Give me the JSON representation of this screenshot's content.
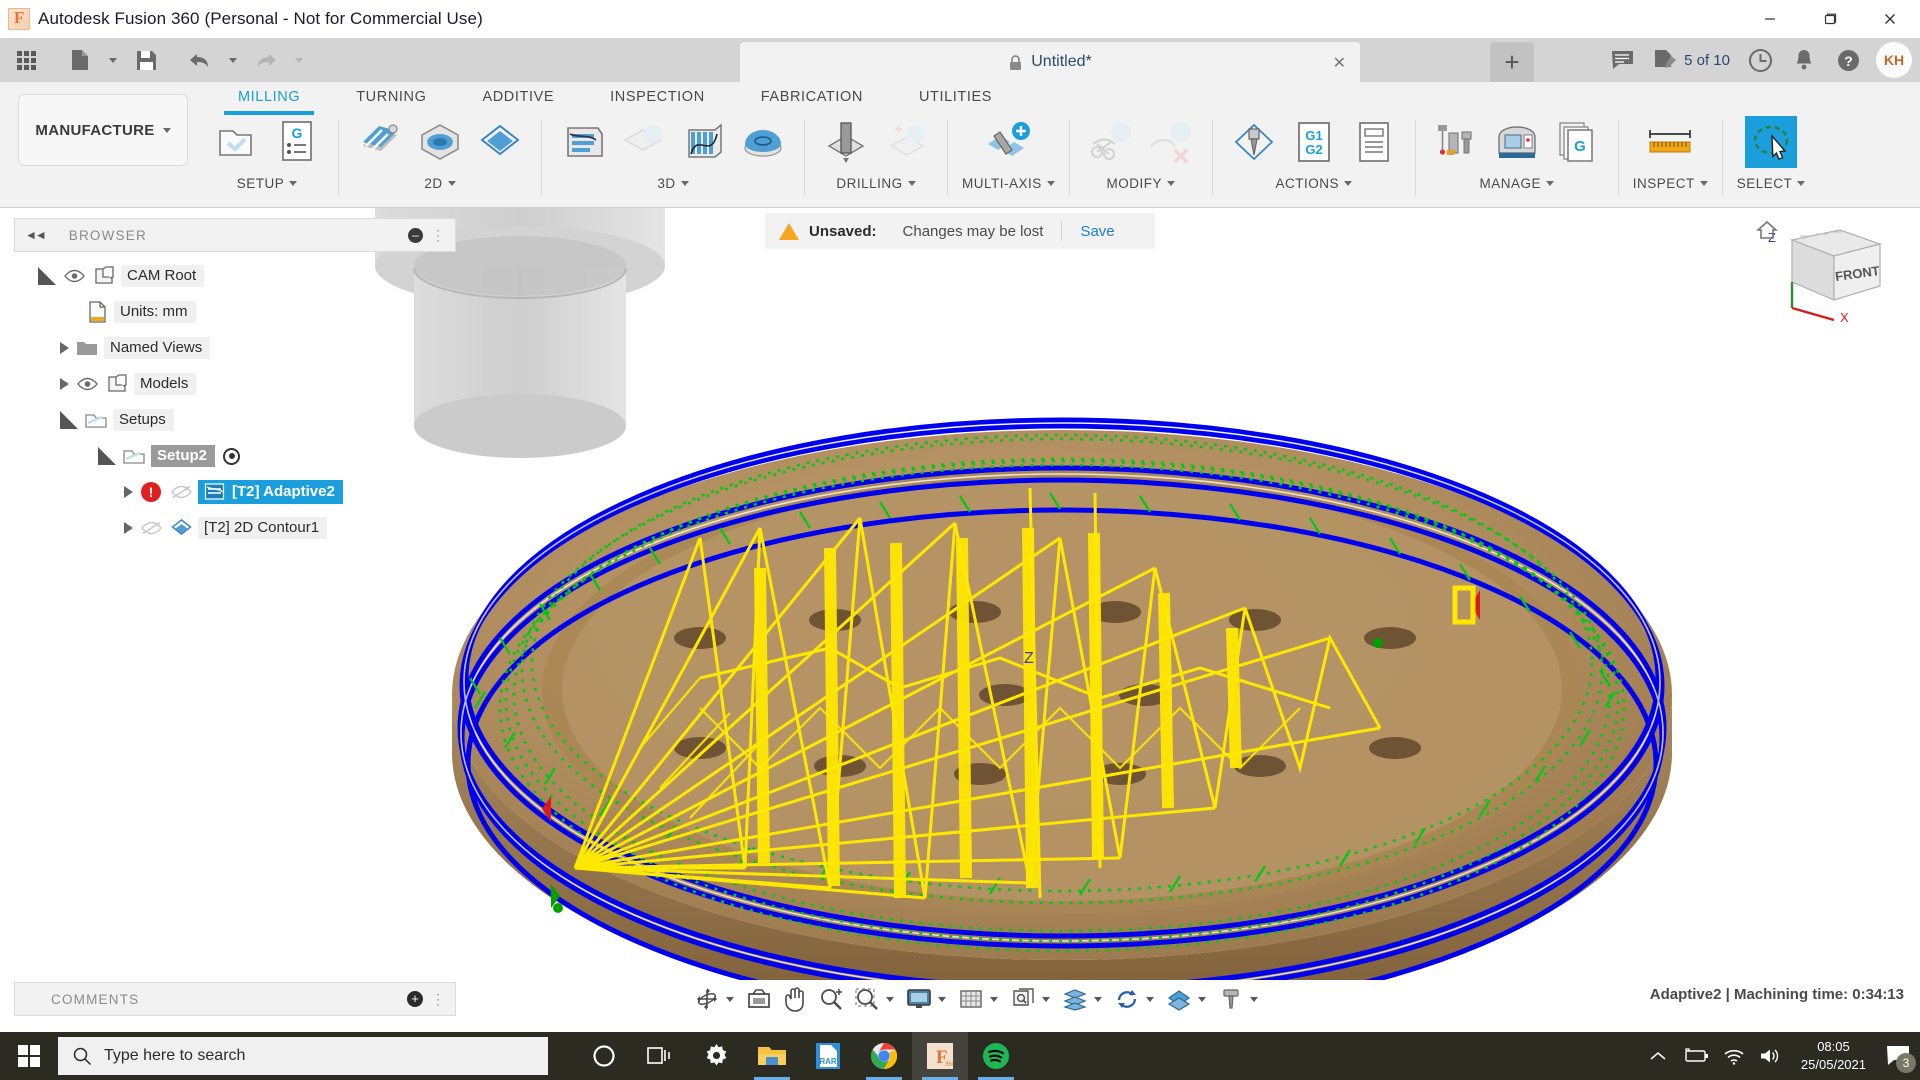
{
  "window": {
    "app_title": "Autodesk Fusion 360 (Personal - Not for Commercial Use)",
    "minimize_label": "–",
    "maximize_label": "❐",
    "close_label": "✕"
  },
  "quick_access": {
    "grid_icon": "app-grid-icon",
    "new_icon": "new-document-icon",
    "save_icon": "save-icon",
    "undo_icon": "undo-icon",
    "redo_icon": "redo-icon",
    "document_tab": {
      "title": "Untitled*",
      "lock_icon": "lock-icon",
      "close_label": "✕"
    },
    "new_tab_label": "+",
    "comment_icon": "comment-icon",
    "jobs_label": "5 of 10",
    "jobs_icon": "job-status-icon",
    "history_icon": "clock-icon",
    "notifications_icon": "bell-icon",
    "help_icon": "help-icon",
    "user_initials": "KH"
  },
  "ribbon": {
    "workspace": "MANUFACTURE",
    "tabs": [
      {
        "label": "MILLING",
        "active": true
      },
      {
        "label": "TURNING",
        "active": false
      },
      {
        "label": "ADDITIVE",
        "active": false
      },
      {
        "label": "INSPECTION",
        "active": false
      },
      {
        "label": "FABRICATION",
        "active": false
      },
      {
        "label": "UTILITIES",
        "active": false
      }
    ],
    "groups": [
      {
        "label": "SETUP",
        "dropdown": true
      },
      {
        "label": "2D",
        "dropdown": true
      },
      {
        "label": "3D",
        "dropdown": true
      },
      {
        "label": "DRILLING",
        "dropdown": true
      },
      {
        "label": "MULTI-AXIS",
        "dropdown": true
      },
      {
        "label": "MODIFY",
        "dropdown": true
      },
      {
        "label": "ACTIONS",
        "dropdown": true
      },
      {
        "label": "MANAGE",
        "dropdown": true
      },
      {
        "label": "INSPECT",
        "dropdown": true
      },
      {
        "label": "SELECT",
        "dropdown": true
      }
    ]
  },
  "browser": {
    "title": "BROWSER",
    "collapse_icon": "collapse-left-icon",
    "minimize_icon": "minimize-panel-icon",
    "grip_icon": "resize-grip-icon",
    "tree": [
      {
        "label": "CAM Root",
        "indent": 0,
        "expander": "open",
        "eye": "on",
        "icon": "body-icon"
      },
      {
        "label": "Units: mm",
        "indent": 1,
        "expander": "none",
        "eye": "none",
        "icon": "units-document-icon"
      },
      {
        "label": "Named Views",
        "indent": 1,
        "expander": "closed",
        "eye": "none",
        "icon": "folder-icon"
      },
      {
        "label": "Models",
        "indent": 1,
        "expander": "closed",
        "eye": "on",
        "icon": "body-icon"
      },
      {
        "label": "Setups",
        "indent": 1,
        "expander": "open",
        "eye": "none",
        "icon": "setup-icon"
      },
      {
        "label": "Setup2",
        "indent": 2,
        "expander": "open",
        "eye": "none",
        "icon": "setup-icon",
        "style": "setup",
        "radio": true
      },
      {
        "label": "[T2] Adaptive2",
        "indent": 3,
        "expander": "closed",
        "eye": "off",
        "icon": "adaptive-toolpath-icon",
        "style": "selected",
        "error": true
      },
      {
        "label": "[T2] 2D Contour1",
        "indent": 3,
        "expander": "closed",
        "eye": "off",
        "icon": "contour-toolpath-icon"
      }
    ]
  },
  "toast": {
    "warning_icon": "warning-triangle-icon",
    "label": "Unsaved:",
    "message": "Changes may be lost",
    "action": "Save"
  },
  "viewcube": {
    "home_icon": "home-icon",
    "face": "FRONT",
    "axis_z": "Z",
    "axis_x": "X"
  },
  "comments": {
    "title": "COMMENTS",
    "add_icon": "add-comment-icon",
    "grip_icon": "resize-grip-icon"
  },
  "navbar": {
    "items": [
      {
        "name": "orbit-icon",
        "dropdown": true
      },
      {
        "name": "look-at-icon",
        "dropdown": false
      },
      {
        "name": "pan-icon",
        "dropdown": false
      },
      {
        "name": "zoom-icon",
        "dropdown": false
      },
      {
        "name": "zoom-window-icon",
        "dropdown": true
      },
      {
        "name": "display-settings-icon",
        "dropdown": true
      },
      {
        "name": "grid-snaps-icon",
        "dropdown": true
      },
      {
        "name": "viewports-icon",
        "dropdown": true
      },
      {
        "name": "stock-visibility-icon",
        "dropdown": true
      },
      {
        "name": "simulate-icon",
        "dropdown": true
      },
      {
        "name": "toolpath-visibility-icon",
        "dropdown": true
      },
      {
        "name": "tool-filter-icon",
        "dropdown": true
      }
    ]
  },
  "status": {
    "text": "Adaptive2 | Machining time: 0:34:13"
  },
  "taskbar": {
    "start_icon": "windows-start-icon",
    "search_icon": "search-icon",
    "search_placeholder": "Type here to search",
    "items": [
      {
        "name": "cortana-icon",
        "active": false,
        "running": false
      },
      {
        "name": "task-view-icon",
        "active": false,
        "running": false
      },
      {
        "name": "settings-icon",
        "active": false,
        "running": false
      },
      {
        "name": "file-explorer-icon",
        "active": false,
        "running": true
      },
      {
        "name": "winrar-icon",
        "active": false,
        "running": false
      },
      {
        "name": "chrome-icon",
        "active": false,
        "running": true
      },
      {
        "name": "fusion360-icon",
        "active": true,
        "running": true
      },
      {
        "name": "spotify-icon",
        "active": false,
        "running": true
      }
    ],
    "tray": {
      "chevron_icon": "show-hidden-icons-icon",
      "battery_icon": "battery-charging-icon",
      "wifi_icon": "wifi-icon",
      "volume_icon": "volume-icon",
      "time": "08:05",
      "date": "25/05/2021",
      "notifications_icon": "action-center-icon",
      "notifications_count": "3"
    }
  },
  "colors": {
    "accent_blue": "#1a9fdc",
    "link_blue": "#1a7fd4",
    "warning_orange": "#f5a623",
    "error_red": "#e02020",
    "toolpath_yellow": "#ffe800",
    "toolpath_green": "#00c814",
    "toolpath_blue": "#0000ee",
    "stock_tan": "#b08d5e",
    "taskbar_dark": "#2b2b22"
  }
}
